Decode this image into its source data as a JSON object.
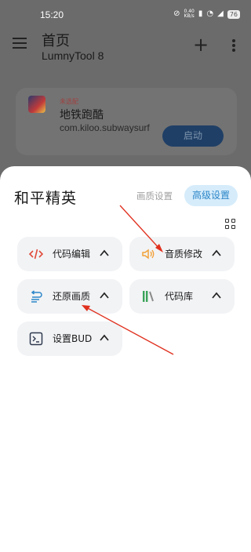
{
  "status_bar": {
    "time": "15:20",
    "net_speed_value": "0.40",
    "net_speed_unit": "KB/s",
    "battery": "76"
  },
  "header": {
    "title": "首页",
    "subtitle": "LumnyTool 8",
    "icons": [
      "menu-icon",
      "plus-icon",
      "more-icon"
    ]
  },
  "game_card": {
    "tag": "未选配",
    "name": "地铁跑酷",
    "package": "com.kiloo.subwaysurf",
    "launch_label": "启动"
  },
  "sheet": {
    "title": "和平精英",
    "tabs": [
      {
        "label": "画质设置",
        "active": false
      },
      {
        "label": "高级设置",
        "active": true
      }
    ],
    "tiles": [
      {
        "label": "代码编辑",
        "icon": "code-icon",
        "icon_color": "#e04b3a"
      },
      {
        "label": "音质修改",
        "icon": "speaker-icon",
        "icon_color": "#f2a23a"
      },
      {
        "label": "还原画质",
        "icon": "restore-icon",
        "icon_color": "#2b86c9"
      },
      {
        "label": "代码库",
        "icon": "library-icon",
        "icon_color": "#3aa35a"
      },
      {
        "label": "设置BUD",
        "icon": "terminal-icon",
        "icon_color": "#2f3a4f"
      }
    ]
  },
  "colors": {
    "accent": "#2b86c9",
    "accent_bg": "#d6ecfb",
    "arrow": "#e0301e"
  }
}
